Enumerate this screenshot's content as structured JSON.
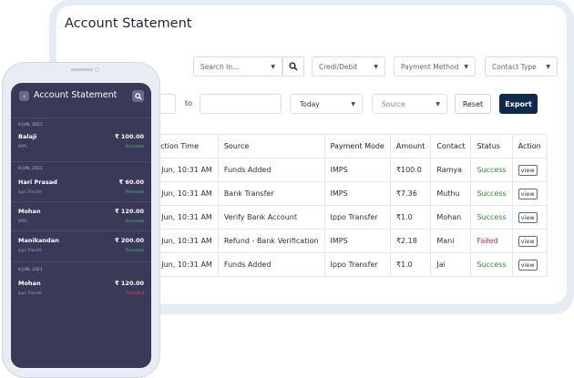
{
  "desktop": {
    "title": "Account Statement",
    "search": {
      "value": "",
      "placeholder": "Search In..."
    },
    "filters": {
      "credit_debit": "Credi/Debit",
      "payment_method": "Payment Method",
      "contact_type": "Contact Type"
    },
    "date_range": {
      "from": "",
      "to_label": "to",
      "to": ""
    },
    "period": "Today",
    "source": "Source",
    "reset_label": "Reset",
    "export_label": "Export",
    "table": {
      "headers": [
        "nsaction Time",
        "Source",
        "Payment Mode",
        "Amount",
        "Contact",
        "Status",
        "Action"
      ],
      "rows": [
        {
          "time": "d 9 Jun, 10:31 AM",
          "source": "Funds Added",
          "mode": "IMPS",
          "amount": "₹100.0",
          "contact": "Ramya",
          "status": "Success",
          "action": "view"
        },
        {
          "time": "d 9 Jun, 10:31 AM",
          "source": "Bank Transfer",
          "mode": "IMPS",
          "amount": "₹7.36",
          "contact": "Muthu",
          "status": "Success",
          "action": "view"
        },
        {
          "time": "d 9 Jun, 10:31 AM",
          "source": "Verify Bank Account",
          "mode": "Ippo Transfer",
          "amount": "₹1.0",
          "contact": "Mohan",
          "status": "Success",
          "action": "view"
        },
        {
          "time": "d 9 Jun, 10:31 AM",
          "source": "Refund - Bank Verification",
          "mode": "IMPS",
          "amount": "₹2.18",
          "contact": "Mani",
          "status": "Failed",
          "action": "view"
        },
        {
          "time": "d 9 Jun, 10:31 AM",
          "source": "Funds Added",
          "mode": "Ippo Transfer",
          "amount": "₹1.0",
          "contact": "Jai",
          "status": "Success",
          "action": "view"
        }
      ]
    }
  },
  "phone": {
    "title": "Account Statement",
    "groups": [
      {
        "date": "9 JUN, 2021",
        "items": [
          {
            "name": "Balaji",
            "amount": "₹ 100.00",
            "type": "IMPS",
            "status": "Processed"
          }
        ]
      },
      {
        "date": "8 JUN, 2021",
        "items": [
          {
            "name": "Hari Prasad",
            "amount": "₹ 60.00",
            "type": "Ippo Transfer",
            "status": "Processed"
          },
          {
            "name": "Mohan",
            "amount": "₹ 120.00",
            "type": "IMPS",
            "status": "Processed"
          },
          {
            "name": "Manikandan",
            "amount": "₹ 200.00",
            "type": "Ippo Transfer",
            "status": "Processed"
          }
        ]
      },
      {
        "date": "8 JUN, 2021",
        "items": [
          {
            "name": "Mohan",
            "amount": "₹ 120.00",
            "type": "Ippo Transfer",
            "status": "Cancelled"
          }
        ]
      }
    ]
  },
  "colors": {
    "success": "#2f8a2f",
    "failed": "#c0392b",
    "processed": "#3ec46d",
    "cancelled": "#e5534b",
    "export_bg": "#0e2a4f",
    "phone_bg": "#3a3a58"
  },
  "icons": {
    "search": "search-icon",
    "back": "chevron-left-icon",
    "phone_search": "search-icon",
    "dropdown": "chevron-down-icon"
  }
}
